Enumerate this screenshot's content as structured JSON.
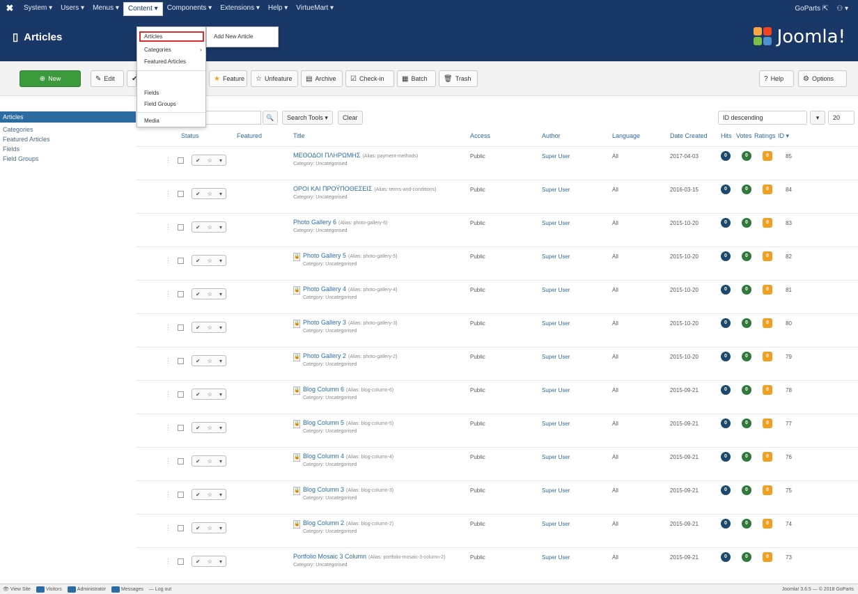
{
  "topbar": {
    "logo": "✖",
    "menu": [
      "System ▾",
      "Users ▾",
      "Menus ▾",
      "Content ▾",
      "Components ▾",
      "Extensions ▾",
      "Help ▾",
      "VirtueMart ▾"
    ],
    "site_user": "GoParts ⇱",
    "user_menu": "⚇ ▾"
  },
  "header": {
    "title": "Articles",
    "brand": "Joomla!"
  },
  "toolbar": {
    "new": "New",
    "edit": "Edit",
    "feature": "Feature",
    "unfeature": "Unfeature",
    "archive": "Archive",
    "checkin": "Check-in",
    "batch": "Batch",
    "trash": "Trash",
    "help": "Help",
    "options": "Options"
  },
  "dropdown": {
    "items": [
      "Articles",
      "Categories",
      "Featured Articles",
      "Fields",
      "Field Groups",
      "Media"
    ],
    "submenu": "Add New Article",
    "categories_arrow": "›"
  },
  "sidebar": [
    "Articles",
    "Categories",
    "Featured Articles",
    "Fields",
    "Field Groups"
  ],
  "filters": {
    "search_tools": "Search Tools ▾",
    "clear": "Clear",
    "ordering": "ID descending",
    "limit": "20"
  },
  "table": {
    "columns": {
      "status": "Status",
      "featured": "Featured",
      "title": "Title",
      "access": "Access",
      "author": "Author",
      "language": "Language",
      "date": "Date Created",
      "hits": "Hits",
      "votes": "Votes",
      "ratings": "Ratings",
      "id": "ID ▾"
    },
    "category_label": "Category: Uncategorised",
    "rows": [
      {
        "title": "ΜΕΘΟΔΟΙ ΠΛΗΡΩΜΗΣ",
        "alias": "(Alias: payment-methods)",
        "access": "Public",
        "author": "Super User",
        "lang": "All",
        "date": "2017-04-03",
        "hits": "0",
        "votes": "0",
        "ratings": "0",
        "id": "85",
        "locked": false
      },
      {
        "title": "ΟΡΟΙ ΚΑΙ ΠΡΟΫΠΟΘΕΣΕΙΣ",
        "alias": "(Alias: terms-and-conditions)",
        "access": "Public",
        "author": "Super User",
        "lang": "All",
        "date": "2016-03-15",
        "hits": "0",
        "votes": "0",
        "ratings": "0",
        "id": "84",
        "locked": false
      },
      {
        "title": "Photo Gallery 6",
        "alias": "(Alias: photo-gallery-6)",
        "access": "Public",
        "author": "Super User",
        "lang": "All",
        "date": "2015-10-20",
        "hits": "0",
        "votes": "0",
        "ratings": "0",
        "id": "83",
        "locked": false
      },
      {
        "title": "Photo Gallery 5",
        "alias": "(Alias: photo-gallery-5)",
        "access": "Public",
        "author": "Super User",
        "lang": "All",
        "date": "2015-10-20",
        "hits": "0",
        "votes": "0",
        "ratings": "0",
        "id": "82",
        "locked": true
      },
      {
        "title": "Photo Gallery 4",
        "alias": "(Alias: photo-gallery-4)",
        "access": "Public",
        "author": "Super User",
        "lang": "All",
        "date": "2015-10-20",
        "hits": "0",
        "votes": "0",
        "ratings": "0",
        "id": "81",
        "locked": true
      },
      {
        "title": "Photo Gallery 3",
        "alias": "(Alias: photo-gallery-3)",
        "access": "Public",
        "author": "Super User",
        "lang": "All",
        "date": "2015-10-20",
        "hits": "0",
        "votes": "0",
        "ratings": "0",
        "id": "80",
        "locked": true
      },
      {
        "title": "Photo Gallery 2",
        "alias": "(Alias: photo-gallery-2)",
        "access": "Public",
        "author": "Super User",
        "lang": "All",
        "date": "2015-10-20",
        "hits": "0",
        "votes": "0",
        "ratings": "0",
        "id": "79",
        "locked": true
      },
      {
        "title": "Blog Column 6",
        "alias": "(Alias: blog-column-6)",
        "access": "Public",
        "author": "Super User",
        "lang": "All",
        "date": "2015-09-21",
        "hits": "0",
        "votes": "0",
        "ratings": "0",
        "id": "78",
        "locked": true
      },
      {
        "title": "Blog Column 5",
        "alias": "(Alias: blog-column-5)",
        "access": "Public",
        "author": "Super User",
        "lang": "All",
        "date": "2015-09-21",
        "hits": "0",
        "votes": "0",
        "ratings": "0",
        "id": "77",
        "locked": true
      },
      {
        "title": "Blog Column 4",
        "alias": "(Alias: blog-column-4)",
        "access": "Public",
        "author": "Super User",
        "lang": "All",
        "date": "2015-09-21",
        "hits": "0",
        "votes": "0",
        "ratings": "0",
        "id": "76",
        "locked": true
      },
      {
        "title": "Blog Column 3",
        "alias": "(Alias: blog-column-3)",
        "access": "Public",
        "author": "Super User",
        "lang": "All",
        "date": "2015-09-21",
        "hits": "0",
        "votes": "0",
        "ratings": "0",
        "id": "75",
        "locked": true
      },
      {
        "title": "Blog Column 2",
        "alias": "(Alias: blog-column-2)",
        "access": "Public",
        "author": "Super User",
        "lang": "All",
        "date": "2015-09-21",
        "hits": "0",
        "votes": "0",
        "ratings": "0",
        "id": "74",
        "locked": true
      },
      {
        "title": "Portfolio Mosaic 3 Column",
        "alias": "(Alias: portfolio-mosaic-3-column-2)",
        "access": "Public",
        "author": "Super User",
        "lang": "All",
        "date": "2015-09-21",
        "hits": "0",
        "votes": "0",
        "ratings": "0",
        "id": "73",
        "locked": false
      }
    ]
  },
  "statusbar": {
    "items": [
      "View Site",
      "Visitors",
      "Administrator",
      "Messages",
      "— Log out"
    ],
    "version": "Joomla! 3.6.5 — © 2018 GoParts"
  },
  "colors": {
    "navbar": "#1a3867",
    "accent": "#2d6ca2",
    "new_button": "#3c9a3c",
    "highlight": "#d32f2f"
  }
}
